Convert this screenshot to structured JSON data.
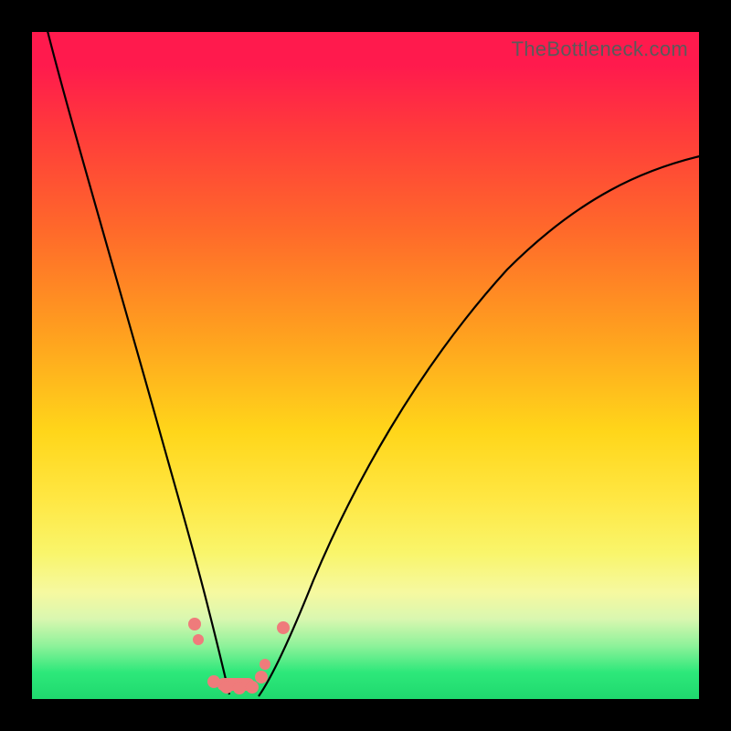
{
  "watermark": "TheBottleneck.com",
  "chart_data": {
    "type": "line",
    "title": "",
    "xlabel": "",
    "ylabel": "",
    "xlim": [
      0,
      100
    ],
    "ylim": [
      0,
      100
    ],
    "gradient_bands": [
      {
        "name": "red",
        "approx_y_range": [
          55,
          100
        ]
      },
      {
        "name": "orange",
        "approx_y_range": [
          35,
          55
        ]
      },
      {
        "name": "yellow",
        "approx_y_range": [
          12,
          35
        ]
      },
      {
        "name": "green",
        "approx_y_range": [
          0,
          12
        ]
      }
    ],
    "series": [
      {
        "name": "left-curve",
        "x": [
          0,
          2,
          5,
          8,
          11,
          14,
          17,
          20,
          22,
          24,
          25.5,
          26.8,
          27.8,
          28.5
        ],
        "y": [
          100,
          92,
          80,
          68,
          56,
          45,
          35,
          25,
          17,
          10,
          5,
          2,
          0.5,
          0
        ]
      },
      {
        "name": "right-curve",
        "x": [
          33,
          35,
          38,
          42,
          48,
          55,
          63,
          72,
          82,
          92,
          100
        ],
        "y": [
          0,
          3,
          9,
          18,
          30,
          41,
          52,
          61,
          69,
          76,
          81
        ]
      }
    ],
    "markers": [
      {
        "x": 24.0,
        "y": 11.0
      },
      {
        "x": 24.6,
        "y": 8.5
      },
      {
        "x": 27.0,
        "y": 1.5
      },
      {
        "x": 28.5,
        "y": 0.8
      },
      {
        "x": 30.5,
        "y": 0.8
      },
      {
        "x": 32.5,
        "y": 0.8
      },
      {
        "x": 34.0,
        "y": 2.5
      },
      {
        "x": 34.5,
        "y": 4.5
      },
      {
        "x": 37.5,
        "y": 10.5
      }
    ]
  }
}
